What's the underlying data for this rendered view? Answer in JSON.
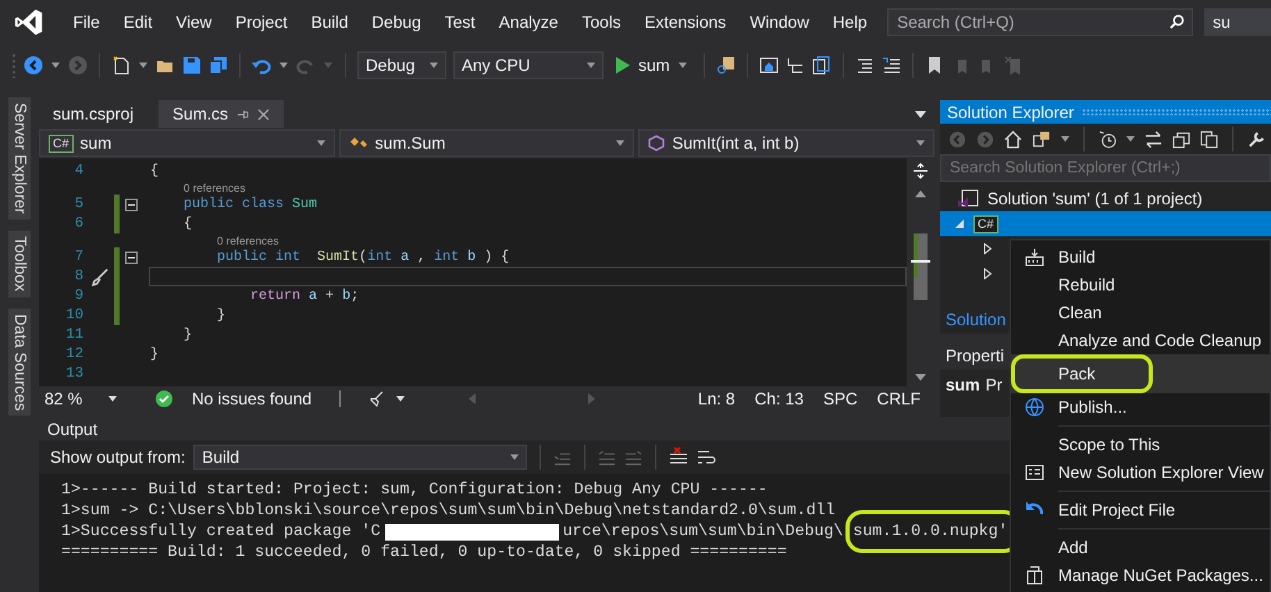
{
  "menubar": {
    "items": [
      "File",
      "Edit",
      "View",
      "Project",
      "Build",
      "Debug",
      "Test",
      "Analyze",
      "Tools",
      "Extensions",
      "Window",
      "Help"
    ],
    "search": {
      "placeholder": "Search (Ctrl+Q)"
    },
    "solution_name": "su"
  },
  "toolbar": {
    "configuration": "Debug",
    "platform": "Any CPU",
    "run_target": "sum"
  },
  "side_tabs": [
    "Server Explorer",
    "Toolbox",
    "Data Sources"
  ],
  "editor": {
    "tabs": [
      {
        "label": "sum.csproj",
        "selected": false
      },
      {
        "label": "Sum.cs",
        "selected": true
      }
    ],
    "nav_badge": "C#",
    "nav": [
      "sum",
      "sum.Sum",
      "SumIt(int a, int b)"
    ],
    "lines": [
      {
        "number": "4",
        "changed": false,
        "foldable": false,
        "current": false,
        "tokens": [
          {
            "kind": "plain",
            "text": "{"
          }
        ]
      },
      {
        "number": "5",
        "changed": true,
        "foldable": true,
        "current": false,
        "lens": "0 references",
        "tokens": [
          {
            "kind": "keyword",
            "text": "    public class "
          },
          {
            "kind": "type",
            "text": "Sum"
          }
        ]
      },
      {
        "number": "6",
        "changed": true,
        "foldable": false,
        "current": false,
        "tokens": [
          {
            "kind": "plain",
            "text": "    {"
          }
        ]
      },
      {
        "number": "7",
        "changed": true,
        "foldable": true,
        "current": false,
        "lens": "0 references",
        "tokens": [
          {
            "kind": "keyword",
            "text": "        public int  "
          },
          {
            "kind": "method",
            "text": "SumIt"
          },
          {
            "kind": "plain",
            "text": "("
          },
          {
            "kind": "keyword",
            "text": "int "
          },
          {
            "kind": "param",
            "text": "a"
          },
          {
            "kind": "plain",
            "text": " , "
          },
          {
            "kind": "keyword",
            "text": "int "
          },
          {
            "kind": "param",
            "text": "b"
          },
          {
            "kind": "plain",
            "text": " ) {"
          }
        ]
      },
      {
        "number": "8",
        "changed": true,
        "foldable": false,
        "current": true
      },
      {
        "number": "9",
        "changed": true,
        "foldable": false,
        "current": false,
        "tokens": [
          {
            "kind": "control",
            "text": "            return "
          },
          {
            "kind": "param",
            "text": "a"
          },
          {
            "kind": "plain",
            "text": " + "
          },
          {
            "kind": "param",
            "text": "b"
          },
          {
            "kind": "plain",
            "text": ";"
          }
        ]
      },
      {
        "number": "10",
        "changed": true,
        "foldable": false,
        "current": false,
        "tokens": [
          {
            "kind": "plain",
            "text": "        }"
          }
        ]
      },
      {
        "number": "11",
        "changed": false,
        "foldable": false,
        "current": false,
        "tokens": [
          {
            "kind": "plain",
            "text": "    }"
          }
        ]
      },
      {
        "number": "12",
        "changed": false,
        "foldable": false,
        "current": false,
        "tokens": [
          {
            "kind": "plain",
            "text": "}"
          }
        ]
      },
      {
        "number": "13",
        "changed": false,
        "foldable": false,
        "current": false
      }
    ],
    "status": {
      "zoom": "82 %",
      "issues": "No issues found",
      "line": "Ln: 8",
      "column": "Ch: 13",
      "whitespace": "SPC",
      "line_endings": "CRLF"
    }
  },
  "solution_explorer": {
    "title": "Solution Explorer",
    "search": {
      "placeholder": "Search Solution Explorer (Ctrl+;)"
    },
    "tree": [
      {
        "label": "Solution 'sum' (1 of 1 project)",
        "selected": false,
        "children": [
          {
            "badge": "C#",
            "selected": true,
            "expanded": true,
            "children": [
              {
                "selected": false,
                "expanded": false
              },
              {
                "selected": false,
                "expanded": false
              }
            ]
          }
        ]
      }
    ],
    "bottom_tab": "Solution"
  },
  "properties": {
    "title": "Properti",
    "object": "sum",
    "type": "Pr"
  },
  "output": {
    "title": "Output",
    "source_label": "Show output from:",
    "source": "Build",
    "lines": [
      {
        "segments": [
          {
            "kind": "text",
            "text": "1>------ Build started: Project: sum, Configuration: Debug Any CPU ------"
          }
        ]
      },
      {
        "segments": [
          {
            "kind": "text",
            "text": "1>sum -> C:\\Users\\bblonski\\source\\repos\\sum\\sum\\bin\\Debug\\netstandard2.0\\sum.dll"
          }
        ]
      },
      {
        "segments": [
          {
            "kind": "text",
            "text": "1>Successfully created package 'C"
          },
          {
            "kind": "redaction"
          },
          {
            "kind": "text",
            "text": "urce\\repos\\sum\\sum\\bin\\Debug\\"
          },
          {
            "kind": "text",
            "text": "sum.1.0.0.nupkg'",
            "circled": true
          }
        ]
      },
      {
        "segments": [
          {
            "kind": "text",
            "text": "========== Build: 1 succeeded, 0 failed, 0 up-to-date, 0 skipped =========="
          }
        ]
      }
    ]
  },
  "context_menu": [
    {
      "kind": "item",
      "label": "Build",
      "selected": false
    },
    {
      "kind": "item",
      "label": "Rebuild",
      "selected": false
    },
    {
      "kind": "item",
      "label": "Clean",
      "selected": false
    },
    {
      "kind": "item",
      "label": "Analyze and Code Cleanup",
      "selected": false
    },
    {
      "kind": "item",
      "label": "Pack",
      "selected": true,
      "circled": true
    },
    {
      "kind": "item",
      "label": "Publish...",
      "selected": false
    },
    {
      "kind": "separator"
    },
    {
      "kind": "item",
      "label": "Scope to This",
      "selected": false
    },
    {
      "kind": "item",
      "label": "New Solution Explorer View",
      "selected": false
    },
    {
      "kind": "separator"
    },
    {
      "kind": "item",
      "label": "Edit Project File",
      "selected": false
    },
    {
      "kind": "separator"
    },
    {
      "kind": "item",
      "label": "Add",
      "selected": false
    },
    {
      "kind": "item",
      "label": "Manage NuGet Packages...",
      "selected": false
    }
  ]
}
